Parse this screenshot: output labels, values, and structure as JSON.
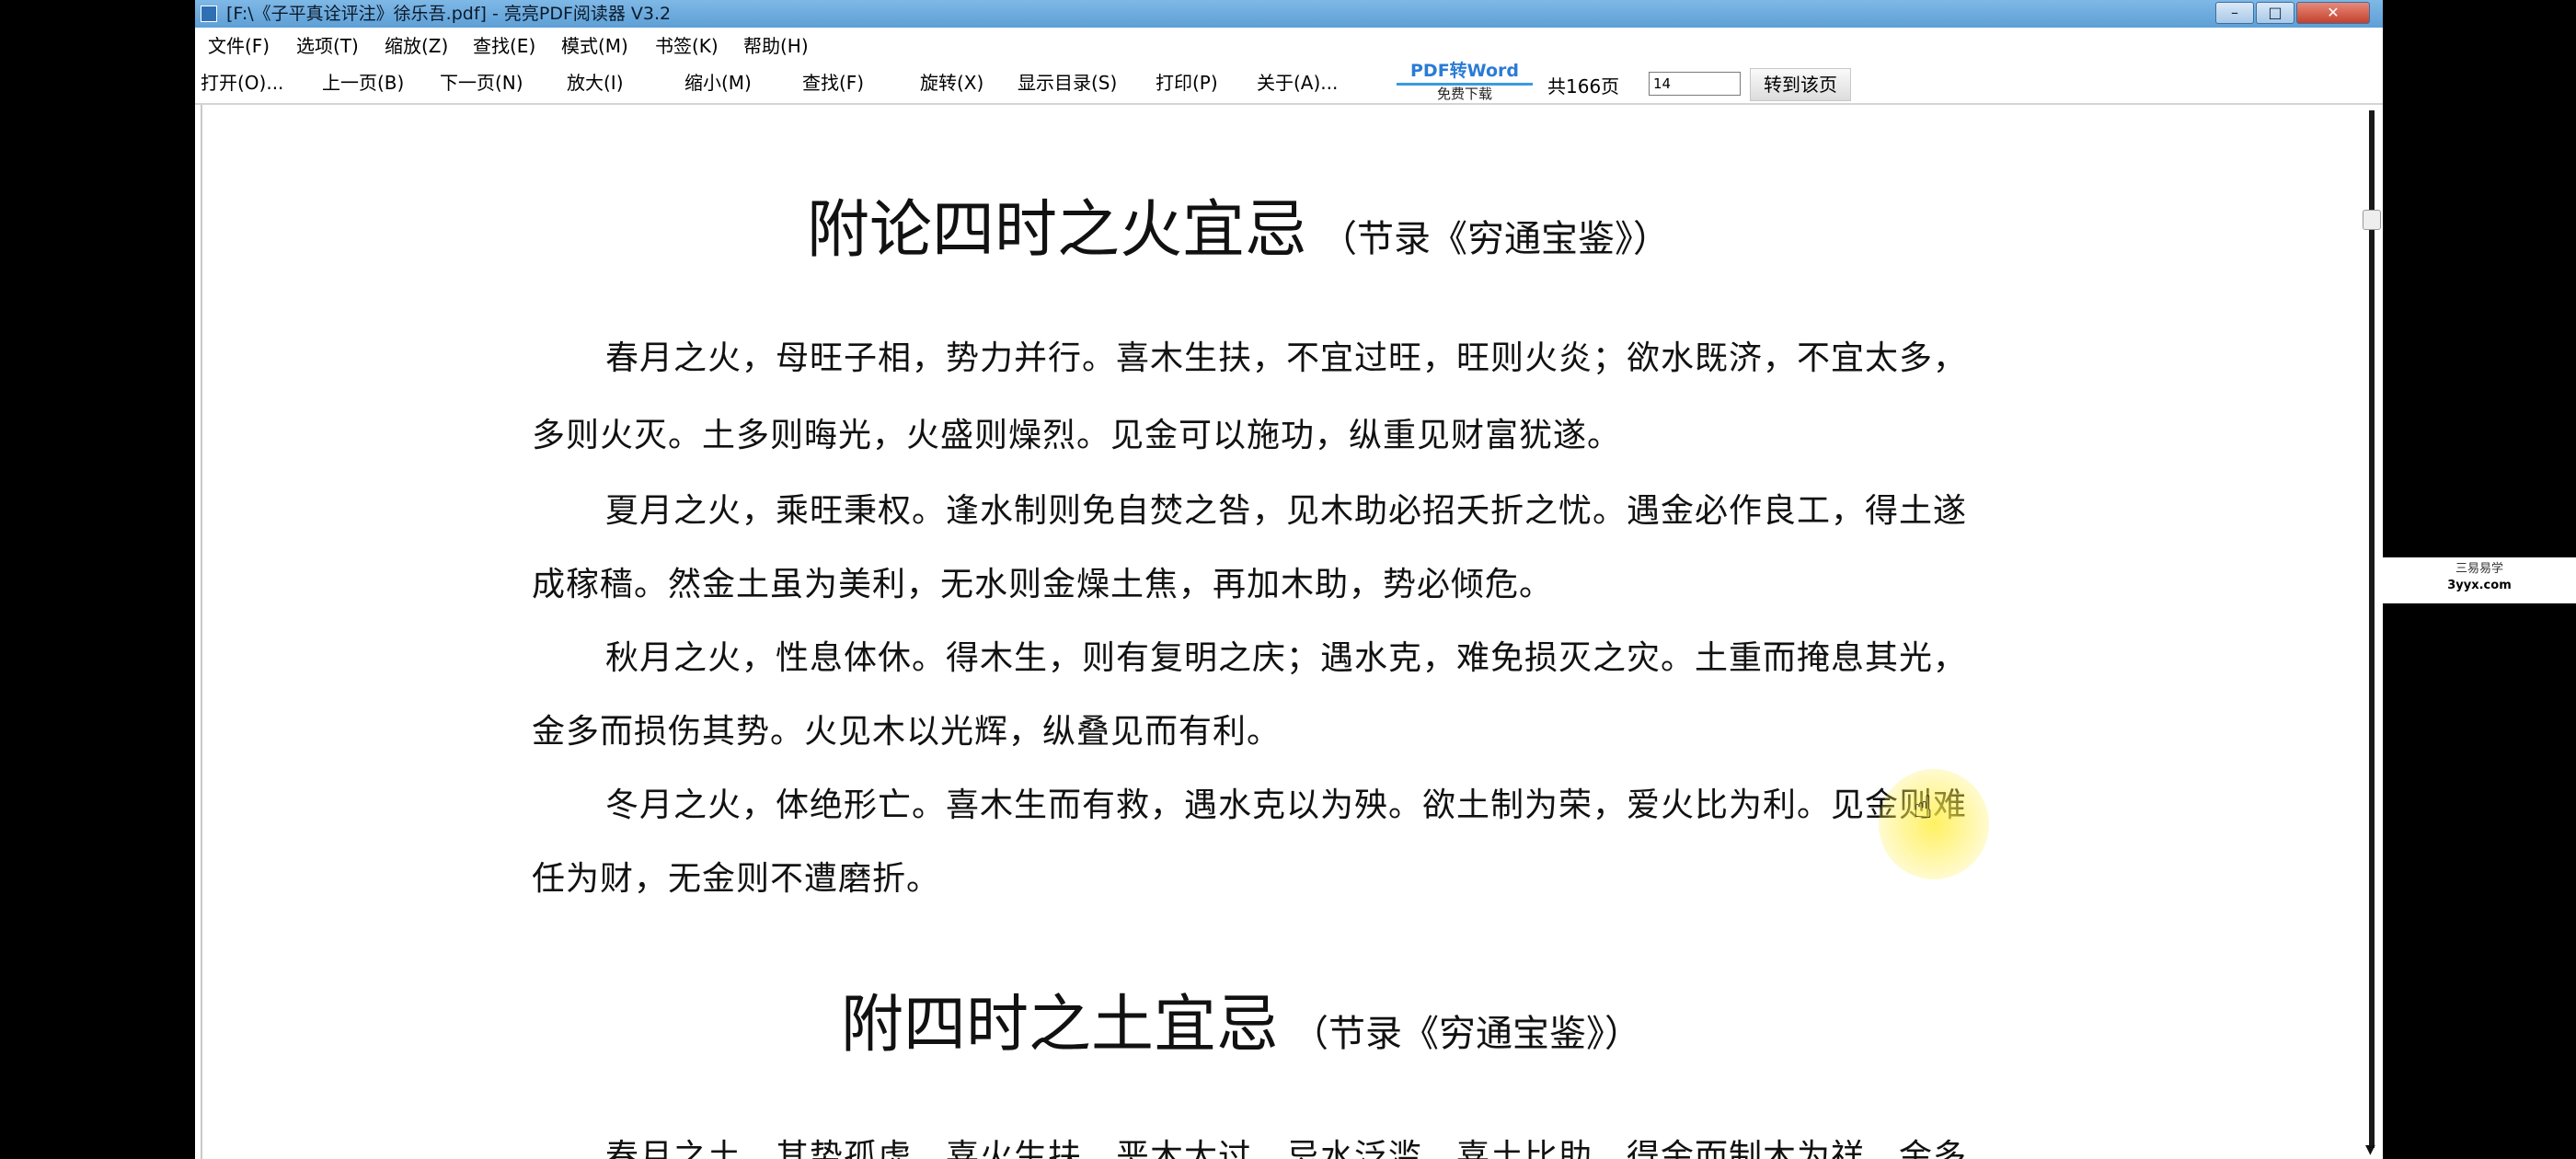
{
  "window": {
    "title": "[F:\\《子平真诠评注》徐乐吾.pdf] - 亮亮PDF阅读器 V3.2",
    "min_label": "–",
    "max_label": "□",
    "close_label": "✕"
  },
  "menu": [
    "文件(F)",
    "选项(T)",
    "缩放(Z)",
    "查找(E)",
    "模式(M)",
    "书签(K)",
    "帮助(H)"
  ],
  "toolbar": {
    "buttons": [
      "打开(O)...",
      "上一页(B)",
      "下一页(N)",
      "放大(I)",
      "缩小(M)",
      "查找(F)",
      "旋转(X)",
      "显示目录(S)",
      "打印(P)",
      "关于(A)..."
    ],
    "pdf2word_label": "PDF转Word",
    "pdf2word_sub": "免费下载",
    "total_pages": "共166页",
    "page_input_value": "14",
    "goto_label": "转到该页"
  },
  "document": {
    "section1": {
      "title": "附论四时之火宜忌",
      "subtitle": "（节录《穷通宝鉴》）",
      "lines": [
        "春月之火，母旺子相，势力并行。喜木生扶，不宜过旺，旺则火炎；欲水既济，不宜太多，",
        "多则火灭。土多则晦光，火盛则燥烈。见金可以施功，纵重见财富犹遂。",
        "夏月之火，乘旺秉权。逢水制则免自焚之咎，见木助必招夭折之忧。遇金必作良工，得土遂",
        "成稼穑。然金土虽为美利，无水则金燥土焦，再加木助，势必倾危。",
        "秋月之火，性息体休。得木生，则有复明之庆；遇水克，难免损灭之灾。土重而掩息其光，",
        "金多而损伤其势。火见木以光辉，纵叠见而有利。",
        "冬月之火，体绝形亡。喜木生而有救，遇水克以为殃。欲土制为荣，爱火比为利。见金则难",
        "任为财，无金则不遭磨折。"
      ]
    },
    "section2": {
      "title": "附四时之土宜忌",
      "subtitle": "（节录《穷通宝鉴》）",
      "lines": [
        "春月之土，其势孤虚。喜火生扶，恶木太过，忌水泛滥，喜土比助。得金而制木为祥，金多"
      ]
    }
  },
  "watermark": {
    "top": "三易易学",
    "bottom": "3yyx.com"
  }
}
